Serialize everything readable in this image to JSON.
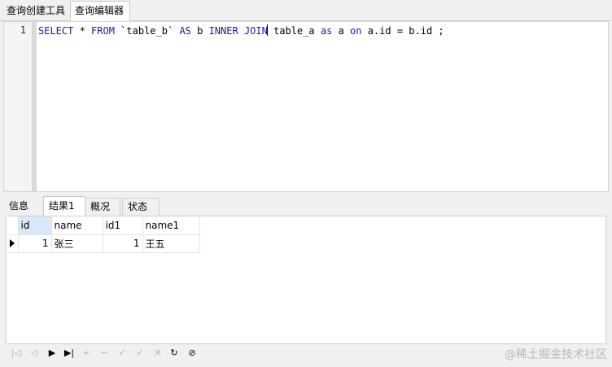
{
  "top_tabs": [
    "查询创建工具",
    "查询编辑器"
  ],
  "editor": {
    "line_number": "1",
    "tokens": [
      {
        "text": "SELECT",
        "kw": true
      },
      {
        "text": " * ",
        "kw": false
      },
      {
        "text": "FROM",
        "kw": true
      },
      {
        "text": " `table_b` ",
        "kw": false
      },
      {
        "text": "AS",
        "kw": true
      },
      {
        "text": " b ",
        "kw": false
      },
      {
        "text": "INNER",
        "kw": true
      },
      {
        "text": " ",
        "kw": false
      },
      {
        "text": "JOIN",
        "kw": true
      },
      {
        "text": " table_a ",
        "kw": false
      },
      {
        "text": "as",
        "kw": true
      },
      {
        "text": " a ",
        "kw": false
      },
      {
        "text": "on",
        "kw": true
      },
      {
        "text": " a.id = b.id ;",
        "kw": false
      }
    ]
  },
  "bottom_tabs": [
    "信息",
    "结果1",
    "概况",
    "状态"
  ],
  "result": {
    "columns": [
      "id",
      "name",
      "id1",
      "name1"
    ],
    "rows": [
      [
        "1",
        "张三",
        "1",
        "王五"
      ]
    ]
  },
  "navbar": {
    "buttons": [
      {
        "name": "first-record-icon",
        "glyph": "|◁",
        "enabled": false
      },
      {
        "name": "previous-record-icon",
        "glyph": "◁",
        "enabled": false
      },
      {
        "name": "next-record-icon",
        "glyph": "▶",
        "enabled": true
      },
      {
        "name": "last-record-icon",
        "glyph": "▶|",
        "enabled": true
      },
      {
        "name": "add-record-icon",
        "glyph": "+",
        "enabled": false
      },
      {
        "name": "delete-record-icon",
        "glyph": "−",
        "enabled": false
      },
      {
        "name": "edit-record-icon",
        "glyph": "✓",
        "enabled": false
      },
      {
        "name": "apply-record-icon",
        "glyph": "✓",
        "enabled": false
      },
      {
        "name": "cancel-record-icon",
        "glyph": "✕",
        "enabled": false
      },
      {
        "name": "refresh-icon",
        "glyph": "↻",
        "enabled": true
      },
      {
        "name": "stop-icon",
        "glyph": "⊘",
        "enabled": true
      }
    ]
  },
  "watermark": "@稀土掘金技术社区",
  "colors": {
    "keyword": "#1a1aa6",
    "selected_header": "#d9e8f7"
  }
}
